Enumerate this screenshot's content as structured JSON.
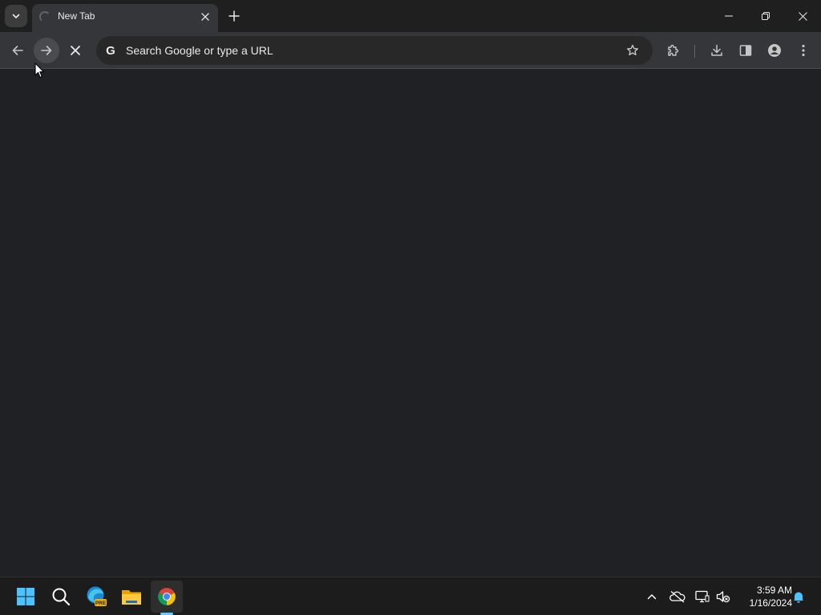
{
  "browser": {
    "tabs": [
      {
        "title": "New Tab",
        "loading": true
      }
    ],
    "omnibox": {
      "placeholder": "Search Google or type a URL"
    },
    "toolbar_icons": [
      "back-icon",
      "forward-icon",
      "stop-icon",
      "google-g-icon",
      "bookmark-star-icon",
      "extensions-icon",
      "download-icon",
      "side-panel-icon",
      "profile-icon",
      "menu-icon"
    ],
    "window_controls": [
      "minimize-icon",
      "restore-icon",
      "close-icon"
    ],
    "colors": {
      "frame": "#1f1f1f",
      "toolbar": "#35363a",
      "content": "#202124",
      "text": "#e8eaed",
      "icon": "#c4c7c5"
    }
  },
  "taskbar": {
    "apps": [
      "windows-start-icon",
      "search-icon",
      "edge-preview-icon",
      "file-explorer-icon",
      "chrome-icon"
    ],
    "edge_badge": "PRE",
    "tray_icons": [
      "chevron-up-icon",
      "onedrive-offline-icon",
      "network-icon",
      "volume-muted-icon",
      "notification-bell-icon"
    ],
    "clock": {
      "time": "3:59 AM",
      "date": "1/16/2024"
    },
    "colors": {
      "background": "#1c1c1c",
      "accent": "#60cdff"
    }
  }
}
